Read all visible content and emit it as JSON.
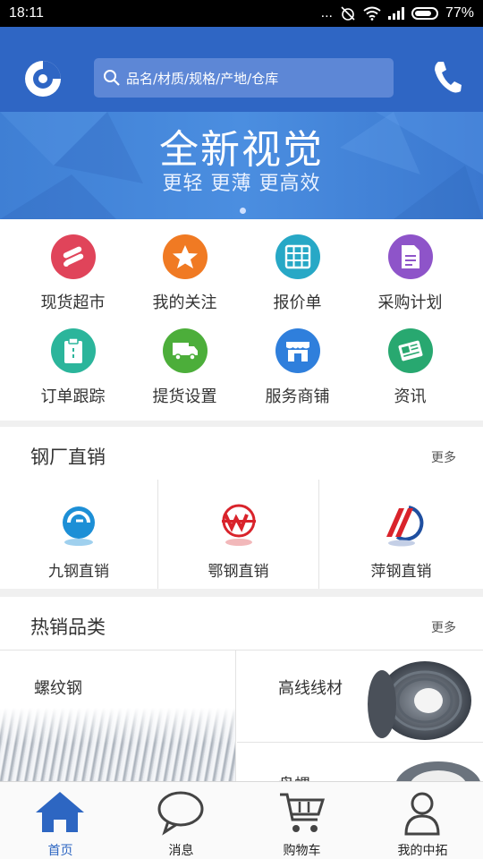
{
  "status_bar": {
    "time": "18:11",
    "dots": "...",
    "battery": "77%"
  },
  "header": {
    "search_placeholder": "品名/材质/规格/产地/仓库"
  },
  "banner": {
    "title": "全新视觉",
    "subtitle": "更轻 更薄 更高效"
  },
  "quick_menu": [
    {
      "label": "现货超市",
      "icon": "steel-bars-icon",
      "color": "#e0445a"
    },
    {
      "label": "我的关注",
      "icon": "star-icon",
      "color": "#f07a23"
    },
    {
      "label": "报价单",
      "icon": "grid-table-icon",
      "color": "#27a8c6"
    },
    {
      "label": "采购计划",
      "icon": "document-icon",
      "color": "#8e54c9"
    },
    {
      "label": "订单跟踪",
      "icon": "clipboard-icon",
      "color": "#2bb59b"
    },
    {
      "label": "提货设置",
      "icon": "truck-icon",
      "color": "#4cae3a"
    },
    {
      "label": "服务商铺",
      "icon": "store-icon",
      "color": "#2f7fdc"
    },
    {
      "label": "资讯",
      "icon": "newspaper-icon",
      "color": "#28a870"
    }
  ],
  "steel_mill": {
    "title": "钢厂直销",
    "more": "更多",
    "brands": [
      {
        "label": "九钢直销",
        "icon": "jiugang-logo-icon"
      },
      {
        "label": "鄂钢直销",
        "icon": "egang-logo-icon"
      },
      {
        "label": "萍钢直销",
        "icon": "pinggang-logo-icon"
      }
    ]
  },
  "hot_categories": {
    "title": "热销品类",
    "more": "更多",
    "items": [
      {
        "label": "螺纹钢"
      },
      {
        "label": "高线线材"
      },
      {
        "label": "盘螺"
      }
    ]
  },
  "tabbar": {
    "active_color": "#2d66c2",
    "tabs": [
      {
        "label": "首页",
        "icon": "home-icon"
      },
      {
        "label": "消息",
        "icon": "chat-bubble-icon"
      },
      {
        "label": "购物车",
        "icon": "cart-icon"
      },
      {
        "label": "我的中拓",
        "icon": "person-icon"
      }
    ]
  }
}
